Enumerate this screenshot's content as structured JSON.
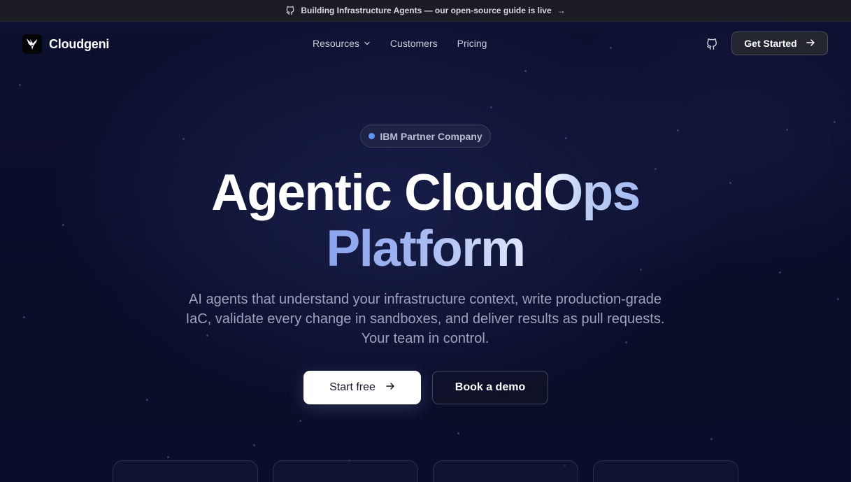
{
  "announcement": {
    "icon": "github-icon",
    "text": "Building Infrastructure Agents — our open-source guide is live",
    "arrow": "→"
  },
  "nav": {
    "brand": "Cloudgeni",
    "logo_icon": "hummingbird-logo-icon",
    "links": [
      {
        "label": "Resources",
        "has_dropdown": true
      },
      {
        "label": "Customers"
      },
      {
        "label": "Pricing"
      }
    ],
    "github_icon": "github-icon",
    "cta_label": "Get Started",
    "cta_arrow": "→"
  },
  "hero": {
    "badge": "IBM Partner Company",
    "headline_part1": "Agentic Cloud",
    "headline_part2": "Ops",
    "headline_line2": "Platform",
    "subtitle": "AI agents that understand your infrastructure context, write production-grade IaC, validate every change in sandboxes, and deliver results as pull requests. Your team in control.",
    "primary_cta": "Start free",
    "primary_arrow": "→",
    "secondary_cta": "Book a demo"
  },
  "colors": {
    "background": "#0b0d24",
    "accent_blue": "#5f94f5",
    "headline_gradient_start": "#8aa4ee",
    "headline_gradient_end": "#dfe6fb"
  }
}
